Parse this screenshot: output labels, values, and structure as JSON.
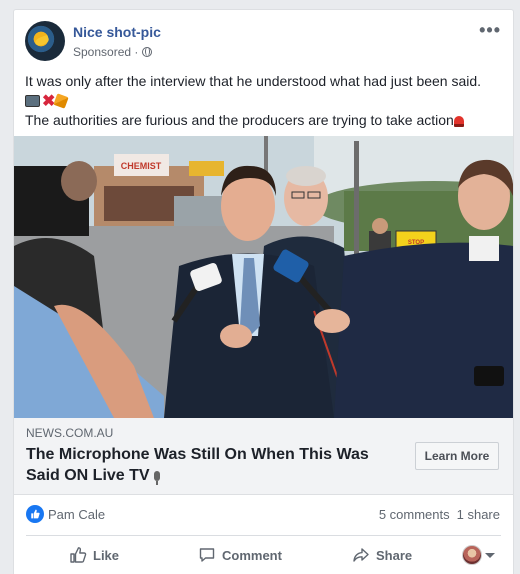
{
  "post": {
    "author": "Nice shot-pic",
    "sponsored": "Sponsored · ",
    "line1": "It was only after the interview that he understood what had just been said.",
    "line3": "The authorities are furious and the producers are trying to take action"
  },
  "link": {
    "domain": "NEWS.COM.AU",
    "headline": "The Microphone Was Still On When This Was Said ON Live TV",
    "cta": "Learn More"
  },
  "photo": {
    "sign_chemist": "CHEMIST",
    "sign_stop": "STOP THE NEW POWER LINE"
  },
  "engagement": {
    "reactor": "Pam Cale",
    "comments": "5 comments",
    "shares": "1 share"
  },
  "actions": {
    "like": "Like",
    "comment": "Comment",
    "share": "Share"
  },
  "colors": {
    "brand": "#365899",
    "like_blue": "#1877f2"
  },
  "icons": [
    "globe-icon",
    "more-icon",
    "tv-emoji",
    "cross-emoji",
    "party-emoji",
    "siren-emoji",
    "microphone-emoji",
    "like-icon",
    "comment-icon",
    "share-icon",
    "caret-down-icon"
  ]
}
